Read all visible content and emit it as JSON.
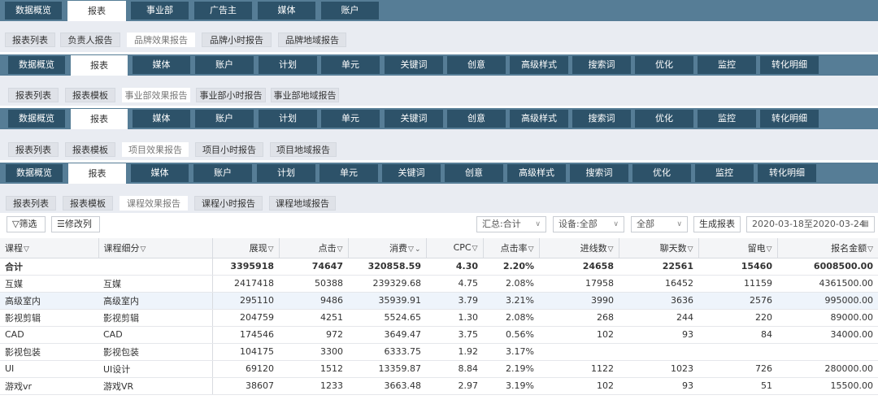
{
  "bar1": {
    "nav": [
      "数据概览",
      "报表",
      "事业部",
      "广告主",
      "媒体",
      "账户"
    ],
    "active_nav": 1,
    "tabs": [
      "报表列表",
      "负责人报告",
      "品牌效果报告",
      "品牌小时报告",
      "品牌地域报告"
    ],
    "active_tab": 2
  },
  "bar2": {
    "nav": [
      "数据概览",
      "报表",
      "媒体",
      "账户",
      "计划",
      "单元",
      "关键词",
      "创意",
      "高级样式",
      "搜索词",
      "优化",
      "监控",
      "转化明细"
    ],
    "active_nav": 1,
    "tabs": [
      "报表列表",
      "报表模板",
      "事业部效果报告",
      "事业部小时报告",
      "事业部地域报告"
    ],
    "active_tab": 2
  },
  "bar3": {
    "nav": [
      "数据概览",
      "报表",
      "媒体",
      "账户",
      "计划",
      "单元",
      "关键词",
      "创意",
      "高级样式",
      "搜索词",
      "优化",
      "监控",
      "转化明细"
    ],
    "active_nav": 1,
    "tabs": [
      "报表列表",
      "报表模板",
      "项目效果报告",
      "项目小时报告",
      "项目地域报告"
    ],
    "active_tab": 2
  },
  "bar4": {
    "nav": [
      "数据概览",
      "报表",
      "媒体",
      "账户",
      "计划",
      "单元",
      "关键词",
      "创意",
      "高级样式",
      "搜索词",
      "优化",
      "监控",
      "转化明细"
    ],
    "active_nav": 1,
    "tabs": [
      "报表列表",
      "报表模板",
      "课程效果报告",
      "课程小时报告",
      "课程地域报告"
    ],
    "active_tab": 2
  },
  "toolbar": {
    "filter_label": "筛选",
    "edit_columns_label": "修改列",
    "summary_select": "汇总:合计",
    "device_select": "设备:全部",
    "all_select": "全部",
    "generate_label": "生成报表",
    "date_range": "2020-03-18至2020-03-24"
  },
  "table": {
    "columns": [
      "课程",
      "课程细分",
      "展现",
      "点击",
      "消费",
      "CPC",
      "点击率",
      "进线数",
      "聊天数",
      "留电",
      "报名金额"
    ],
    "total": [
      "合计",
      "",
      "3395918",
      "74647",
      "320858.59",
      "4.30",
      "2.20%",
      "24658",
      "22561",
      "15460",
      "6008500.00"
    ],
    "rows": [
      [
        "互媒",
        "互媒",
        "2417418",
        "50388",
        "239329.68",
        "4.75",
        "2.08%",
        "17958",
        "16452",
        "11159",
        "4361500.00"
      ],
      [
        "高级室内",
        "高级室内",
        "295110",
        "9486",
        "35939.91",
        "3.79",
        "3.21%",
        "3990",
        "3636",
        "2576",
        "995000.00"
      ],
      [
        "影视剪辑",
        "影视剪辑",
        "204759",
        "4251",
        "5524.65",
        "1.30",
        "2.08%",
        "268",
        "244",
        "220",
        "89000.00"
      ],
      [
        "CAD",
        "CAD",
        "174546",
        "972",
        "3649.47",
        "3.75",
        "0.56%",
        "102",
        "93",
        "84",
        "34000.00"
      ],
      [
        "影视包装",
        "影视包装",
        "104175",
        "3300",
        "6333.75",
        "1.92",
        "3.17%",
        "",
        "",
        "",
        ""
      ],
      [
        "UI",
        "UI设计",
        "69120",
        "1512",
        "13359.87",
        "8.84",
        "2.19%",
        "1122",
        "1023",
        "726",
        "280000.00"
      ],
      [
        "游戏vr",
        "游戏VR",
        "38607",
        "1233",
        "3663.48",
        "2.97",
        "3.19%",
        "102",
        "93",
        "51",
        "15500.00"
      ]
    ]
  },
  "colors": {
    "nav_bar_bg": "#567d96",
    "nav_btn_bg": "#2d5269",
    "sub_bar_bg": "#e9ecf2",
    "highlight_row": "#eef4fb"
  }
}
